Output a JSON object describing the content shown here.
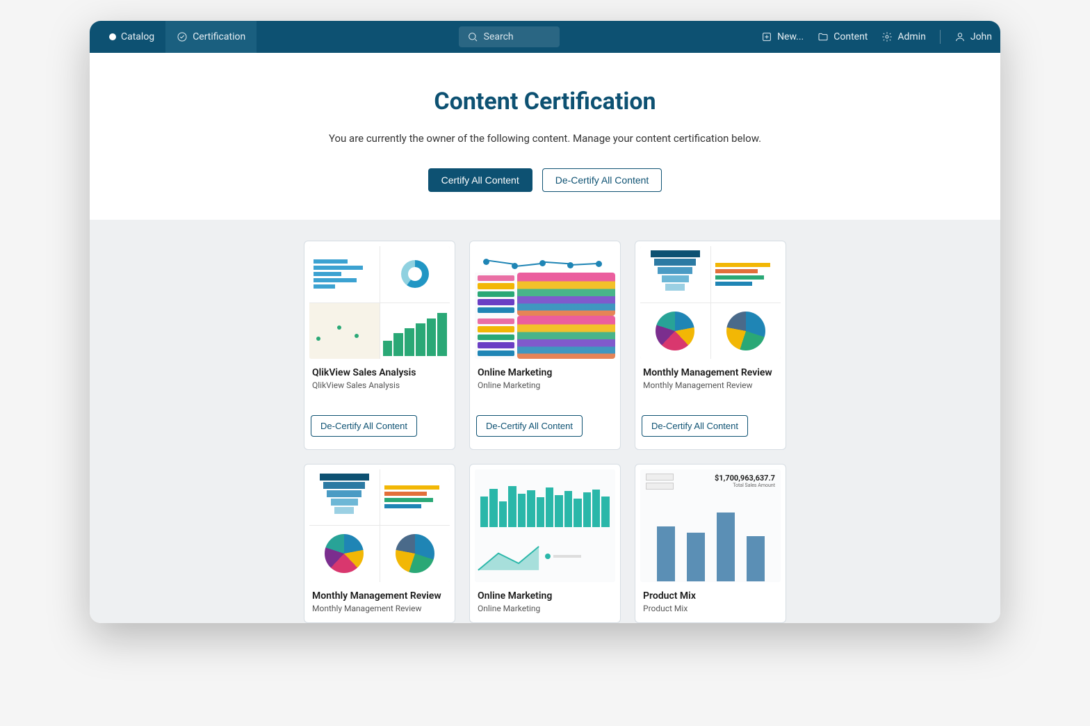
{
  "nav": {
    "catalog": "Catalog",
    "certification": "Certification",
    "search_placeholder": "Search",
    "new": "New...",
    "content": "Content",
    "admin": "Admin",
    "user": "John"
  },
  "header": {
    "title": "Content Certification",
    "subtitle": "You are currently the owner of the following content. Manage your content certification below.",
    "certify_btn": "Certify All Content",
    "decertify_btn": "De-Certify All Content"
  },
  "cards": [
    {
      "title": "QlikView Sales Analysis",
      "subtitle": "QlikView Sales Analysis",
      "action": "De-Certify All Content"
    },
    {
      "title": "Online Marketing",
      "subtitle": "Online Marketing",
      "action": "De-Certify All Content"
    },
    {
      "title": "Monthly Management Review",
      "subtitle": "Monthly Management Review",
      "action": "De-Certify All Content"
    },
    {
      "title": "Monthly Management Review",
      "subtitle": "Monthly Management Review"
    },
    {
      "title": "Online Marketing",
      "subtitle": "Online Marketing"
    },
    {
      "title": "Product Mix",
      "subtitle": "Product Mix",
      "metric_value": "$1,700,963,637.7",
      "metric_label": "Total Sales Amount"
    }
  ]
}
